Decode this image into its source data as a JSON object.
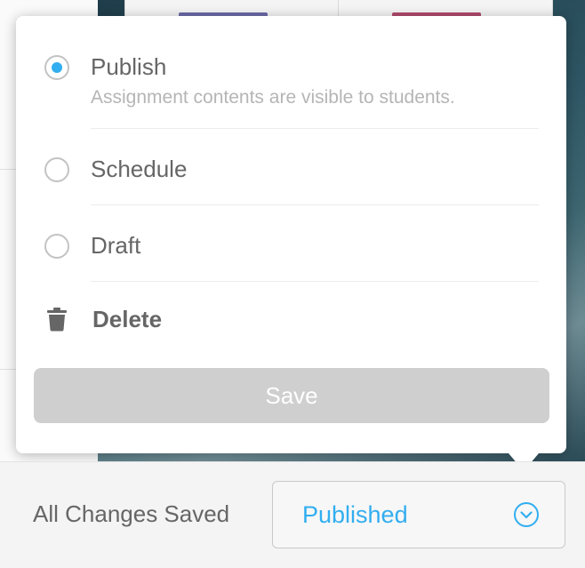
{
  "popover": {
    "options": [
      {
        "label": "Publish",
        "description": "Assignment contents are visible to students.",
        "checked": true
      },
      {
        "label": "Schedule",
        "checked": false
      },
      {
        "label": "Draft",
        "checked": false
      }
    ],
    "delete_label": "Delete",
    "delete_icon": "trash-icon",
    "save_label": "Save"
  },
  "footer": {
    "saved_status": "All Changes Saved",
    "status_value": "Published",
    "status_icon": "chevron-down-circle-icon"
  },
  "colors": {
    "accent": "#32aef0",
    "save_disabled": "#cfcfcf",
    "text": "#666666",
    "muted_text": "#b5b5b5"
  }
}
